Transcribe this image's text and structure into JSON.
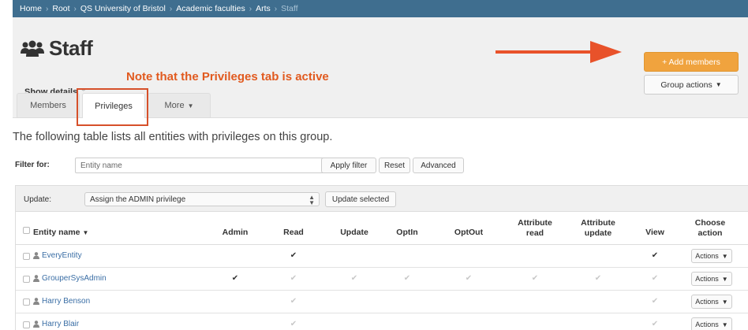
{
  "breadcrumb": [
    {
      "label": "Home"
    },
    {
      "label": "Root"
    },
    {
      "label": "QS University of Bristol"
    },
    {
      "label": "Academic faculties"
    },
    {
      "label": "Arts"
    },
    {
      "label": "Staff",
      "current": true
    }
  ],
  "header": {
    "title": "Staff",
    "show_details": "Show details",
    "add_members": "+ Add members",
    "group_actions": "Group actions"
  },
  "annotation": {
    "note": "Note that the Privileges tab is active",
    "color": "#e15a1f"
  },
  "tabs": [
    {
      "label": "Members",
      "active": false
    },
    {
      "label": "Privileges",
      "active": true
    },
    {
      "label": "More",
      "active": false
    }
  ],
  "intro": "The following table lists all entities with privileges on this group.",
  "filter": {
    "label": "Filter for:",
    "placeholder": "Entity name",
    "apply": "Apply filter",
    "reset": "Reset",
    "advanced": "Advanced"
  },
  "update": {
    "label": "Update:",
    "selected": "Assign the ADMIN privilege",
    "button": "Update selected"
  },
  "table": {
    "headers": {
      "entity": "Entity name",
      "admin": "Admin",
      "read": "Read",
      "update": "Update",
      "optin": "OptIn",
      "optout": "OptOut",
      "attr_read_1": "Attribute",
      "attr_read_2": "read",
      "attr_update_1": "Attribute",
      "attr_update_2": "update",
      "view": "View",
      "choose_1": "Choose",
      "choose_2": "action"
    },
    "actions_label": "Actions",
    "rows": [
      {
        "name": "EveryEntity",
        "admin": "none",
        "read": "on",
        "update": "none",
        "optin": "none",
        "optout": "none",
        "attr_read": "none",
        "attr_update": "none",
        "view": "on"
      },
      {
        "name": "GrouperSysAdmin",
        "admin": "on",
        "read": "off",
        "update": "off",
        "optin": "off",
        "optout": "off",
        "attr_read": "off",
        "attr_update": "off",
        "view": "off"
      },
      {
        "name": "Harry Benson",
        "admin": "none",
        "read": "off",
        "update": "none",
        "optin": "none",
        "optout": "none",
        "attr_read": "none",
        "attr_update": "none",
        "view": "off"
      },
      {
        "name": "Harry Blair",
        "admin": "none",
        "read": "off",
        "update": "none",
        "optin": "none",
        "optout": "none",
        "attr_read": "none",
        "attr_update": "none",
        "view": "off"
      }
    ]
  },
  "colors": {
    "breadcrumb_bg": "#3f6e8f",
    "add_button": "#f0a33e",
    "arrow": "#e8522a",
    "highlight": "#d6502a",
    "link": "#3a6ea5"
  }
}
